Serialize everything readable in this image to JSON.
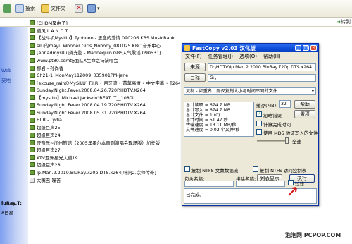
{
  "toolbar": {
    "search_label": "搜索",
    "folders_label": "文件夹",
    "go_label": "转到"
  },
  "left_pane": {
    "texts": [
      "Web",
      "夹地"
    ],
    "bottom_texts": [
      "luRay.T:",
      "8日星"
    ]
  },
  "files": [
    {
      "name": "[CHDM聚由子]",
      "type": "folder"
    },
    {
      "name": "道风 L.A.N.D.T",
      "type": "folder"
    },
    {
      "name": "【战斗机Mysiliu】Typhoon - 思念的爱情 090206 KBS MusicBank",
      "type": "folder"
    },
    {
      "name": "silu的mayu Wonder Girls_Nobody_081025 KBC 音乐中心",
      "type": "folder"
    },
    {
      "name": "[ennadmysilu]龚光影 - Mannequin GBS人气歌谣 090531)",
      "type": "folder"
    },
    {
      "name": "www.pt80.com场面队X生命之诗演唱会",
      "type": "folder"
    },
    {
      "name": "柳岩 - 孙尚香",
      "type": "folder"
    },
    {
      "name": "Ch21-1_MonMay112009_035901PM-jane",
      "type": "folder"
    },
    {
      "name": "[excuse_rain@MySiLU] F.I.R • 月牙湾 • 首草高清 • 中文字幕 • T264",
      "type": "folder"
    },
    {
      "name": "Sunday.Night.Fever.2008.04.26.720P.HDTV.X264",
      "type": "folder"
    },
    {
      "name": "【mysiliu】Michael Jackson\"BEAT IT__1080i",
      "type": "folder"
    },
    {
      "name": "Sunday.Night.Fever.2008.04.19.720P.HDTV.X264",
      "type": "folder"
    },
    {
      "name": "Sunday.Night.Fever.2008.05.31.720P.HDTV.X264",
      "type": "folder"
    },
    {
      "name": "F.I.R - Lydia",
      "type": "folder"
    },
    {
      "name": "超级巨声25",
      "type": "folder"
    },
    {
      "name": "超级巨声24",
      "type": "folder"
    },
    {
      "name": "齐豫乐~加州旅馆（2005年墨尔本音则演唱会现场版）加长版",
      "type": "folder"
    },
    {
      "name": "超级巨声27",
      "type": "folder"
    },
    {
      "name": "ATV亚洲星光大道19",
      "type": "folder"
    },
    {
      "name": "超级巨声28",
      "type": "folder"
    },
    {
      "name": "Ip.Man.2.2010.BluRay.720p.DTS.x264[叶问2.宗师传奇]",
      "type": "folder"
    },
    {
      "name": "大嘴巴-嘴吝",
      "type": "doc"
    }
  ],
  "dialog": {
    "title": "FastCopy v2.03 汉化版",
    "menu": [
      "文件(F)",
      "任务管理(J)",
      "选项(O)",
      "帮助(H)"
    ],
    "source_button": "来源",
    "source_value": "D:\\HDTV\\Ip.Man.2.2010.BluRay.720p.DTS.x264",
    "target_button": "目标",
    "target_value": "G:\\",
    "mode_value": "复制 - 如重名，则仅复制大小与时间不同的文件",
    "info_lines": [
      "总计读取 = 674.7 MB",
      "总计写入 = 674.7 MB",
      "总计文件 = 1 (0)",
      "总计时间 = 51.47 秒",
      "传输速度 = 13.11 MB/秒",
      "文件速度 = 0.02 个文件/秒"
    ],
    "buffer_label": "缓存(MB):",
    "buffer_value": "32",
    "help_button": "帮助",
    "ignore_errors_label": "忽略错误",
    "verify_button": "置项",
    "estimate_label": "计算完成时间",
    "md5_label": "使用 MD5 验证写入的文件",
    "full_speed_label": "全速",
    "list_button": "列表显示",
    "execute_button": "执行",
    "ntfs_stream_label": "复制 NTFS 文数数据流",
    "ntfs_acl_label": "复制 NTFS 访问控制表",
    "include_label": "包含名称:",
    "exclude_label": "排除名称:",
    "filter_label": "过滤",
    "status_text": "已完成。"
  },
  "watermark": "泡泡网 PCPOP.COM"
}
